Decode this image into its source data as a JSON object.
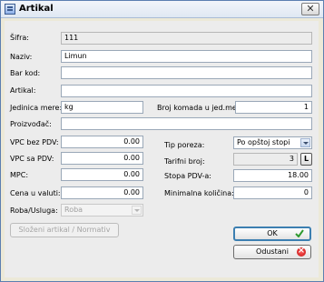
{
  "window": {
    "title": "Artikal",
    "close_glyph": "✕"
  },
  "form": {
    "sifra": {
      "label": "Šifra:",
      "value": "111"
    },
    "naziv": {
      "label": "Naziv:",
      "value": "Limun"
    },
    "bar_kod": {
      "label": "Bar kod:",
      "value": ""
    },
    "artikal": {
      "label": "Artikal:",
      "value": ""
    },
    "jedinica_mere": {
      "label": "Jedinica mere:",
      "value": "kg"
    },
    "broj_komada": {
      "label": "Broj komada u jed.mere:",
      "value": "1"
    },
    "proizvodjac": {
      "label": "Proizvođač:",
      "value": ""
    },
    "vpc_bez_pdv": {
      "label": "VPC bez PDV:",
      "value": "0.00"
    },
    "vpc_sa_pdv": {
      "label": "VPC sa PDV:",
      "value": "0.00"
    },
    "mpc": {
      "label": "MPC:",
      "value": "0.00"
    },
    "cena_u_valuti": {
      "label": "Cena u valuti:",
      "value": "0.00"
    },
    "roba_usluga": {
      "label": "Roba/Usluga:",
      "value": "Roba"
    },
    "tip_poreza": {
      "label": "Tip poreza:",
      "value": "Po opštoj stopi"
    },
    "tarifni_broj": {
      "label": "Tarifni broj:",
      "value": "3",
      "button": "L"
    },
    "stopa_pdv": {
      "label": "Stopa PDV-a:",
      "value": "18.00"
    },
    "minimalna_kolicina": {
      "label": "Minimalna količina:",
      "value": "0"
    }
  },
  "buttons": {
    "slozeni": "Složeni artikal / Normativ",
    "ok": "OK",
    "odustani": "Odustani"
  },
  "icons": {
    "app": "form-icon",
    "ok": "checkmark-icon",
    "cancel": "red-x-icon"
  },
  "colors": {
    "focus_border": "#3c7fb1",
    "cancel_red": "#d01818",
    "ok_green": "#2e9a2e"
  }
}
